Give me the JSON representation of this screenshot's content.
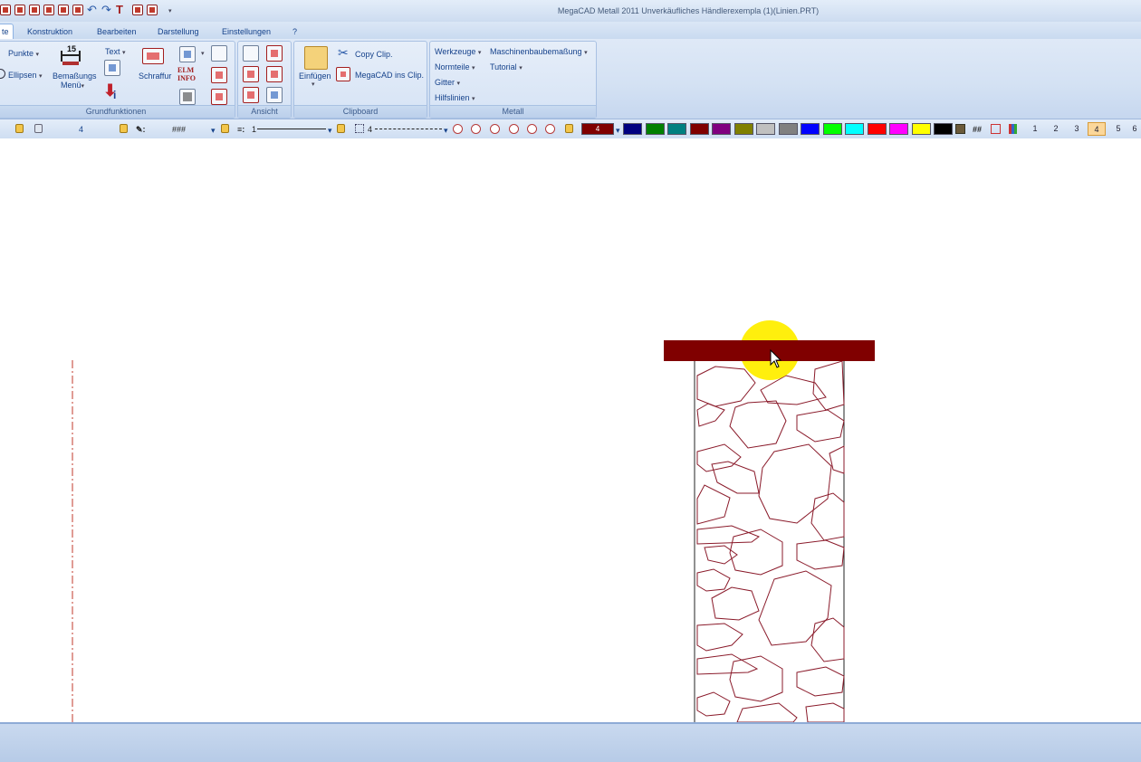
{
  "window": {
    "title": "MegaCAD Metall 2011  Unverkäufliches Händlerexempla (1)(Linien.PRT)"
  },
  "tabs": [
    {
      "label": "te",
      "active": true
    },
    {
      "label": "Konstruktion"
    },
    {
      "label": "Bearbeiten"
    },
    {
      "label": "Darstellung"
    },
    {
      "label": "Einstellungen"
    },
    {
      "label": "?"
    }
  ],
  "ribbon": {
    "grund": {
      "punkte": "Punkte",
      "ellipsen": "Ellipsen",
      "bemassung_line1": "Bemaßungs",
      "bemassung_line2": "Menü",
      "bemassung_num": "15",
      "text": "Text",
      "schraffur": "Schraffur",
      "elm_line1": "ELM",
      "elm_line2": "INFO",
      "group_label": "Grundfunktionen"
    },
    "ansicht": {
      "group_label": "Ansicht"
    },
    "clipboard": {
      "einfuegen": "Einfügen",
      "copy": "Copy Clip.",
      "megacad_clip": "MegaCAD ins Clip.",
      "group_label": "Clipboard"
    },
    "metall": {
      "werkzeuge": "Werkzeuge",
      "maschinenbau": "Maschinenbaubemaßung",
      "normteile": "Normteile",
      "tutorial": "Tutorial",
      "gitter": "Gitter",
      "hilfslinien": "Hilfslinien",
      "group_label": "Metall"
    }
  },
  "attributes": {
    "layer_value": "4",
    "pattern": "###",
    "line_width": "1",
    "line_type": "4",
    "current_color_label": "4",
    "current_color": "#800000",
    "hash_label": "##",
    "palette": [
      "#000080",
      "#008000",
      "#008080",
      "#800000",
      "#800080",
      "#808000",
      "#c0c0c0",
      "#808080",
      "#0000ff",
      "#00ff00",
      "#00ffff",
      "#ff0000",
      "#ff00ff",
      "#ffff00",
      "#000000"
    ],
    "layers": [
      {
        "label": "1"
      },
      {
        "label": "2"
      },
      {
        "label": "3"
      },
      {
        "label": "4",
        "active": true
      },
      {
        "label": "5"
      },
      {
        "label": "6"
      }
    ]
  },
  "drawing": {
    "beam_color": "#800000",
    "stone_line_color": "#8a1a2a",
    "centerline_color": "#c0392b",
    "highlight_color": "#ffee00"
  }
}
